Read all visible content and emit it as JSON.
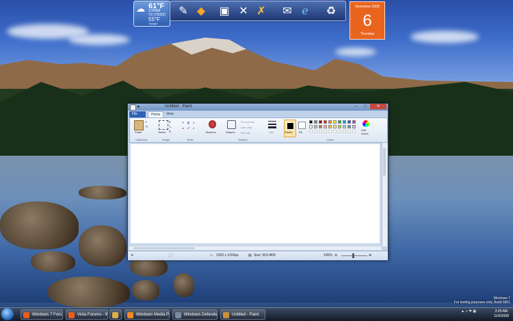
{
  "weather": {
    "temp": "61°F",
    "time": "2:26AM",
    "location": "TX (75052)",
    "low": "55°F",
    "label": "Tonight"
  },
  "calendar": {
    "month": "November 2008",
    "day": "6",
    "weekday": "Thursday"
  },
  "dock": {
    "icons": [
      "paint-tools-icon",
      "hazard-sign-icon",
      "computer-icon",
      "tools-icon",
      "wrench-tools-icon",
      "mail-icon",
      "internet-explorer-icon",
      "recycle-bin-icon"
    ]
  },
  "paint": {
    "title": "Untitled - Paint",
    "tabs": [
      "File",
      "Home",
      "View"
    ],
    "groups": {
      "clipboard": "Clipboard",
      "image": "Image",
      "tools": "Tools",
      "shapes": "Shapes",
      "colors": "Colors"
    },
    "buttons": {
      "paste": "Paste",
      "select": "Select",
      "brushes": "Brushes",
      "shapes": "Shapes",
      "size": "Size",
      "color1": "Stroke",
      "color2": "Fill",
      "edit_colors": "Edit colors"
    },
    "shape_options": [
      "Fill and line",
      "Line only",
      "Fill only"
    ],
    "palette": [
      "#000000",
      "#7f7f7f",
      "#880015",
      "#ed1c24",
      "#ff7f27",
      "#fff200",
      "#22b14c",
      "#00a2e8",
      "#3f48cc",
      "#a349a4",
      "#ffffff",
      "#c3c3c3",
      "#b97a57",
      "#ffaec9",
      "#ffc90e",
      "#efe4b0",
      "#b5e61d",
      "#99d9ea",
      "#7092be",
      "#c8bfe7"
    ],
    "status": {
      "size": "1920 x 1200px",
      "filesize": "Size: 553.4KB",
      "zoom": "100%"
    }
  },
  "taskbar": {
    "items": [
      {
        "label": "Windows 7 Foru...",
        "color": "#e85b1b"
      },
      {
        "label": "Vista Forums - Wi...",
        "color": "#e85b1b"
      },
      {
        "label": "",
        "color": "#d8b04a"
      },
      {
        "label": "Windows Media P...",
        "color": "#f08a24"
      },
      {
        "label": "Windows Defender",
        "color": "#7a8aa3"
      },
      {
        "label": "Untitled - Paint",
        "color": "#c8913a"
      }
    ],
    "clock_time": "2:25 AM",
    "clock_date": "11/6/2008"
  },
  "watermark": {
    "line1": "Windows 7",
    "line2": "For testing purposes only. Build 6801"
  }
}
